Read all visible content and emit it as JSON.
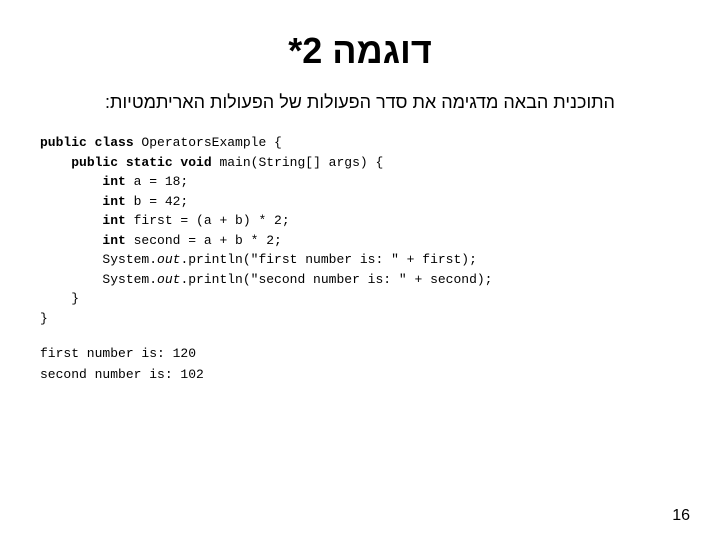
{
  "title": "דוגמה 2*",
  "subtitle": "התוכנית הבאה מדגימה את סדר הפעולות של הפעולות האריתמטיות:",
  "code": {
    "line1": "public class OperatorsExample {",
    "line2": "    public static void main(String[] args) {",
    "line3": "        int a = 18;",
    "line4": "        int b = 42;",
    "line5": "        int first = (a + b) * 2;",
    "line6": "        int second = a + b * 2;",
    "line7": "        System.out.println(\"first number is: \" + first);",
    "line8": "        System.out.println(\"second number is: \" + second);",
    "line9": "    }",
    "line10": "}"
  },
  "output": {
    "line1": "first number is: 120",
    "line2": "second number is: 102"
  },
  "page_number": "16"
}
